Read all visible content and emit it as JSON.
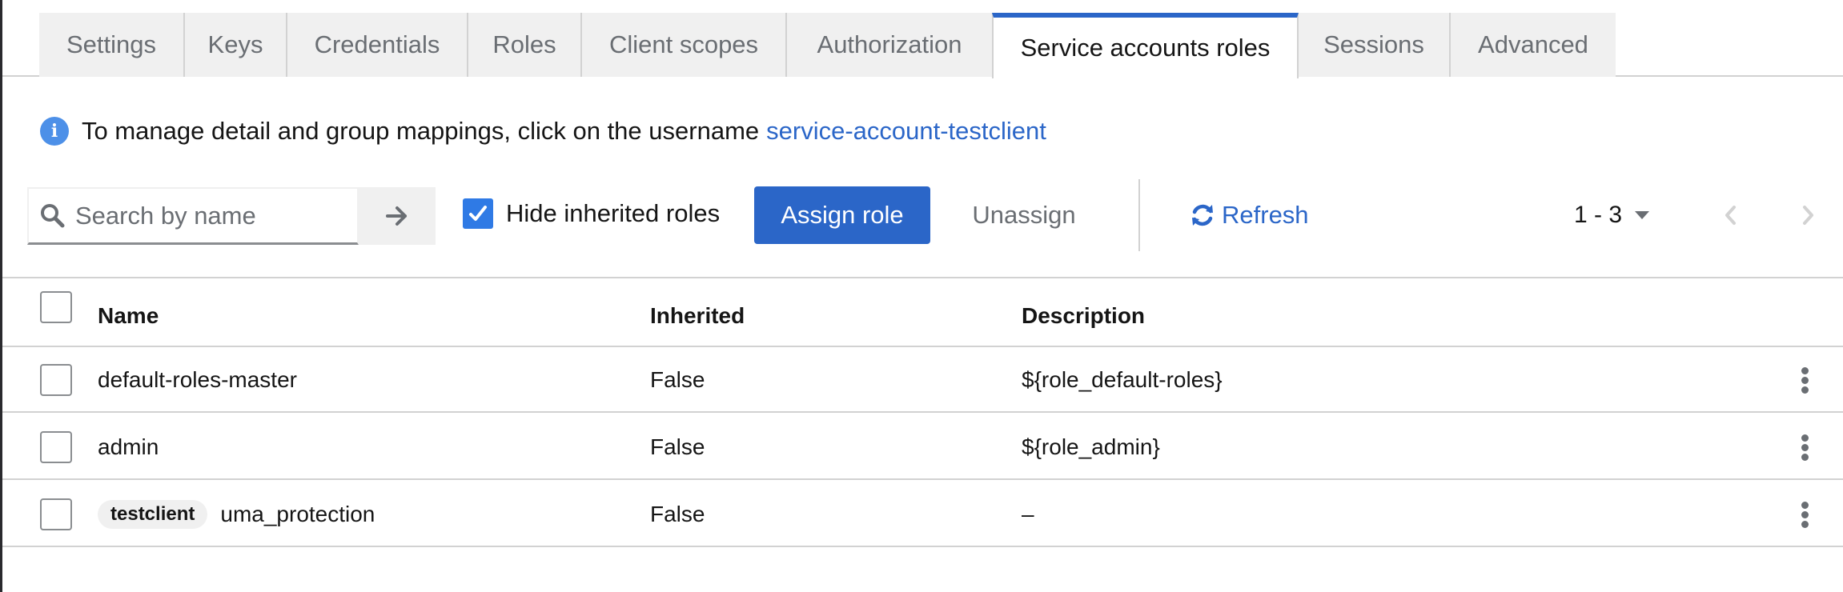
{
  "tabs": [
    {
      "label": "Settings",
      "active": false
    },
    {
      "label": "Keys",
      "active": false
    },
    {
      "label": "Credentials",
      "active": false
    },
    {
      "label": "Roles",
      "active": false
    },
    {
      "label": "Client scopes",
      "active": false
    },
    {
      "label": "Authorization",
      "active": false
    },
    {
      "label": "Service accounts roles",
      "active": true
    },
    {
      "label": "Sessions",
      "active": false
    },
    {
      "label": "Advanced",
      "active": false
    }
  ],
  "info": {
    "icon": "info-circle-icon",
    "text": "To manage detail and group mappings, click on the username",
    "link": "service-account-testclient"
  },
  "toolbar": {
    "search_placeholder": "Search by name",
    "search_value": "",
    "hide_inherited_label": "Hide inherited roles",
    "hide_inherited_checked": true,
    "assign_label": "Assign role",
    "unassign_label": "Unassign",
    "refresh_label": "Refresh",
    "pagination_label": "1 - 3"
  },
  "table": {
    "columns": [
      "Name",
      "Inherited",
      "Description"
    ],
    "rows": [
      {
        "badge": "",
        "name": "default-roles-master",
        "inherited": "False",
        "description": "${role_default-roles}"
      },
      {
        "badge": "",
        "name": "admin",
        "inherited": "False",
        "description": "${role_admin}"
      },
      {
        "badge": "testclient",
        "name": "uma_protection",
        "inherited": "False",
        "description": "–"
      }
    ]
  },
  "colors": {
    "accent": "#2b66c8",
    "checkbox": "#2f7ae5",
    "info_icon": "#4d90e8"
  }
}
